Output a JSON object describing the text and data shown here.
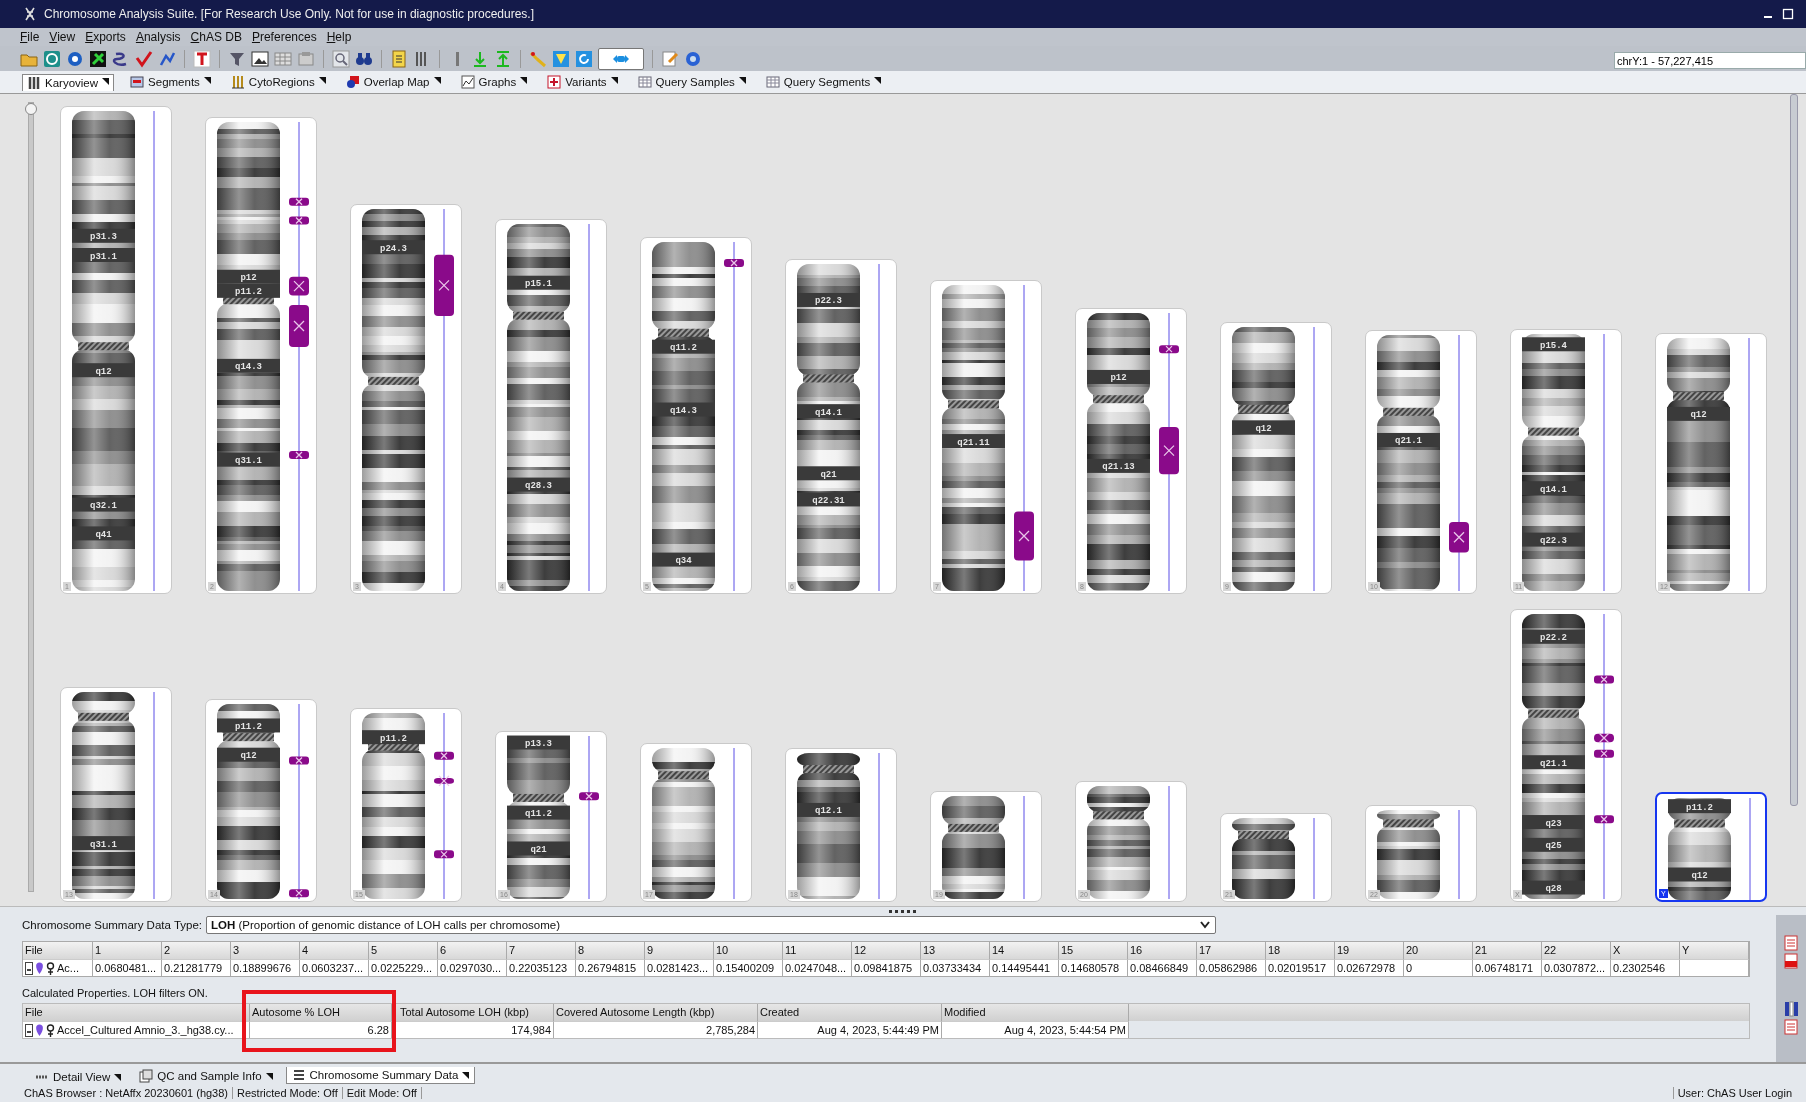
{
  "window": {
    "title": "Chromosome Analysis Suite. [For Research Use Only. Not for use in diagnostic procedures.]"
  },
  "menu": [
    "File",
    "View",
    "Exports",
    "Analysis",
    "ChAS DB",
    "Preferences",
    "Help"
  ],
  "location_field": {
    "value": "chrY:1 - 57,227,415"
  },
  "tabs": [
    {
      "label": "Karyoview",
      "selected": true
    },
    {
      "label": "Segments",
      "selected": false
    },
    {
      "label": "CytoRegions",
      "selected": false
    },
    {
      "label": "Overlap Map",
      "selected": false
    },
    {
      "label": "Graphs",
      "selected": false
    },
    {
      "label": "Variants",
      "selected": false
    },
    {
      "label": "Query Samples",
      "selected": false
    },
    {
      "label": "Query Segments",
      "selected": false
    }
  ],
  "zoom_slider": {
    "level": 0
  },
  "chromosomes": [
    {
      "number": "1",
      "selected": false,
      "bands": [
        "p31.3",
        "p31.1",
        "q12",
        "q32.1",
        "q41"
      ]
    },
    {
      "number": "2",
      "selected": false,
      "bands": [
        "p12",
        "p11.2",
        "q14.3",
        "q31.1"
      ]
    },
    {
      "number": "3",
      "selected": false,
      "bands": [
        "p24.3"
      ]
    },
    {
      "number": "4",
      "selected": false,
      "bands": [
        "p15.1",
        "q28.3"
      ]
    },
    {
      "number": "5",
      "selected": false,
      "bands": [
        "q11.2",
        "q14.3",
        "q34"
      ]
    },
    {
      "number": "6",
      "selected": false,
      "bands": [
        "p22.3",
        "q14.1",
        "q21",
        "q22.31"
      ]
    },
    {
      "number": "7",
      "selected": false,
      "bands": [
        "q21.11"
      ]
    },
    {
      "number": "8",
      "selected": false,
      "bands": [
        "p12",
        "q21.13"
      ]
    },
    {
      "number": "9",
      "selected": false,
      "bands": [
        "q12"
      ]
    },
    {
      "number": "10",
      "selected": false,
      "bands": [
        "q21.1"
      ]
    },
    {
      "number": "11",
      "selected": false,
      "bands": [
        "p15.4",
        "q14.1",
        "q22.3"
      ]
    },
    {
      "number": "12",
      "selected": false,
      "bands": [
        "q12"
      ]
    },
    {
      "number": "13",
      "selected": false,
      "bands": [
        "q31.1"
      ]
    },
    {
      "number": "14",
      "selected": false,
      "bands": [
        "p11.2",
        "q12"
      ]
    },
    {
      "number": "15",
      "selected": false,
      "bands": [
        "p11.2"
      ]
    },
    {
      "number": "16",
      "selected": false,
      "bands": [
        "p13.3",
        "q11.2",
        "q21"
      ]
    },
    {
      "number": "17",
      "selected": false
    },
    {
      "number": "18",
      "selected": false,
      "bands": [
        "q12.1"
      ]
    },
    {
      "number": "19",
      "selected": false
    },
    {
      "number": "20",
      "selected": false
    },
    {
      "number": "21",
      "selected": false
    },
    {
      "number": "22",
      "selected": false
    },
    {
      "number": "X",
      "selected": false,
      "bands": [
        "p22.2",
        "q21.1",
        "q23",
        "q25",
        "q28"
      ]
    },
    {
      "number": "Y",
      "selected": true,
      "bands": [
        "p11.2",
        "q12"
      ]
    }
  ],
  "summary": {
    "type_label": "Chromosome Summary Data Type:",
    "type_value": "**LOH** (Proportion of genomic distance of LOH calls per chromosome)",
    "columns": [
      "File",
      "1",
      "2",
      "3",
      "4",
      "5",
      "6",
      "7",
      "8",
      "9",
      "10",
      "11",
      "12",
      "13",
      "14",
      "15",
      "16",
      "17",
      "18",
      "19",
      "20",
      "21",
      "22",
      "X",
      "Y"
    ],
    "rows": [
      [
        "Ac...",
        "0.0680481...",
        "0.21281779",
        "0.18899676",
        "0.0603237...",
        "0.0225229...",
        "0.0297030...",
        "0.22035123",
        "0.26794815",
        "0.0281423...",
        "0.15400209",
        "0.0247048...",
        "0.09841875",
        "0.03733434",
        "0.14495441",
        "0.14680578",
        "0.08466849",
        "0.05862986",
        "0.02019517",
        "0.02672978",
        "0",
        "0.06748171",
        "0.0307872...",
        "0.2302546",
        ""
      ]
    ]
  },
  "properties": {
    "caption": "Calculated Properties. LOH filters ON.",
    "columns": [
      "File",
      "Autosome % LOH",
      "Total Autosome LOH (kbp)",
      "Covered Autosome Length (kbp)",
      "Created",
      "Modified"
    ],
    "highlight_box": true,
    "rows": [
      [
        "Accel_Cultured Amnio_3._hg38.cy...",
        "6.28",
        "174,984",
        "2,785,284",
        "Aug 4, 2023, 5:44:49 PM",
        "Aug 4, 2023, 5:44:54 PM"
      ]
    ]
  },
  "bottom_tabs": [
    {
      "label": "Detail View",
      "selected": false
    },
    {
      "label": "QC and Sample Info",
      "selected": false
    },
    {
      "label": "Chromosome Summary Data",
      "selected": true
    }
  ],
  "status_bar": {
    "items": [
      "ChAS Browser : NetAffx 20230601 (hg38)",
      "Restricted Mode: Off",
      "Edit Mode: Off"
    ],
    "user": "User: ChAS User Login"
  }
}
